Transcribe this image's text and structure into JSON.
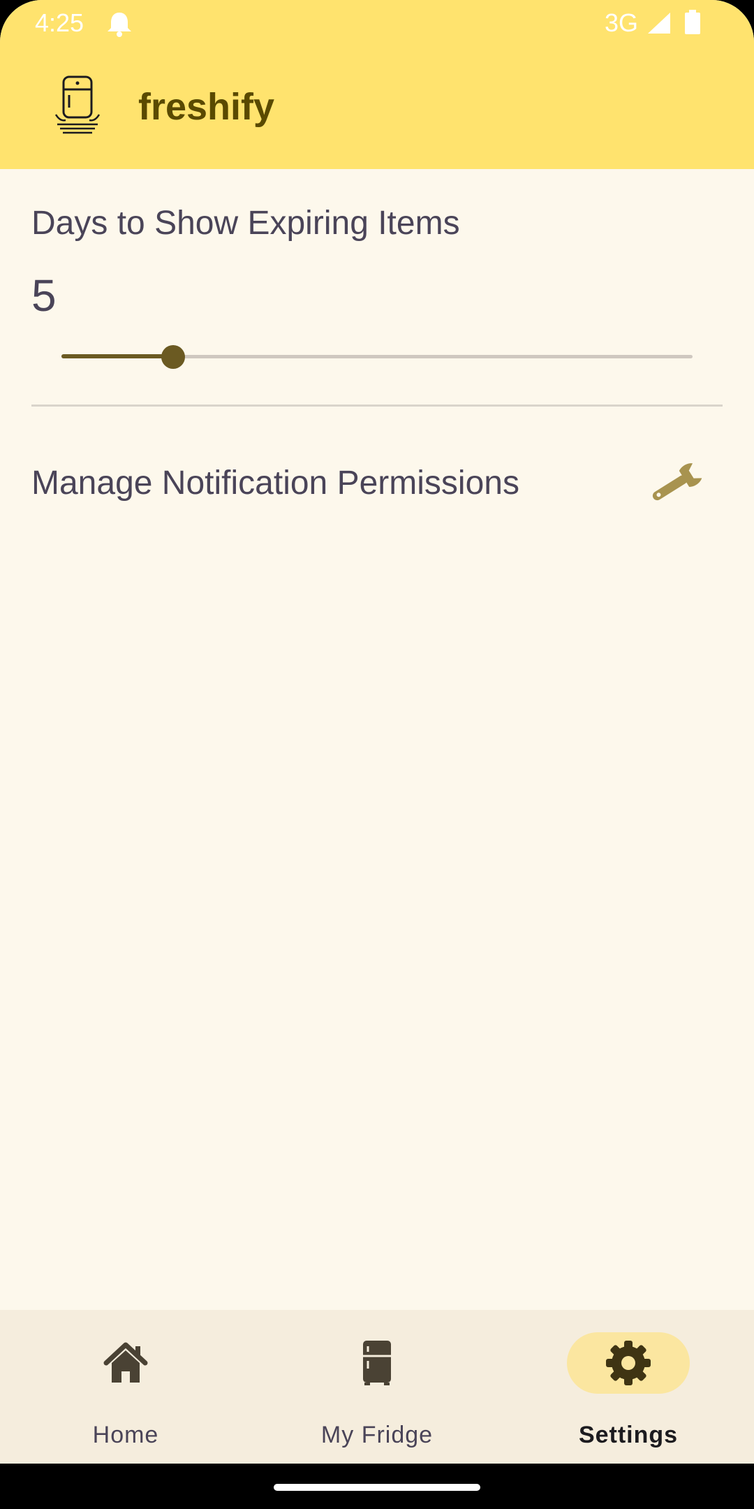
{
  "status_bar": {
    "time": "4:25",
    "network": "3G",
    "icons": [
      "notification-bell-icon",
      "signal-icon",
      "battery-icon"
    ]
  },
  "app_bar": {
    "title": "freshify",
    "logo_icon": "fridge-logo-icon"
  },
  "settings": {
    "days_label": "Days to Show Expiring Items",
    "days_value": "5",
    "slider_fraction": 0.177,
    "permissions_label": "Manage Notification Permissions",
    "permissions_icon": "wrench-icon"
  },
  "bottom_nav": {
    "items": [
      {
        "label": "Home",
        "icon": "home-icon",
        "active": false
      },
      {
        "label": "My Fridge",
        "icon": "fridge-icon",
        "active": false
      },
      {
        "label": "Settings",
        "icon": "gear-icon",
        "active": true
      }
    ]
  },
  "colors": {
    "app_bar": "#FFE36E",
    "background": "#FDF8EC",
    "accent": "#6B5A22",
    "nav_background": "#F5EDDD",
    "active_pill": "#FBE6A0"
  }
}
